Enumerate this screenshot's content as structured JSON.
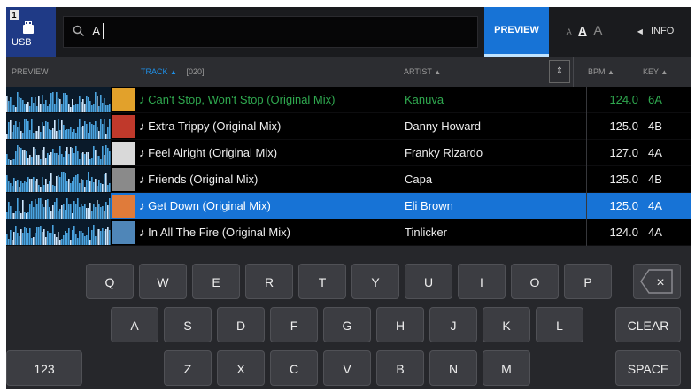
{
  "top_bar": {
    "source_number": "1",
    "source_label": "USB",
    "search_query": "A",
    "preview_label": "PREVIEW",
    "font_size_glyphs": [
      "A",
      "A",
      "A"
    ],
    "info_label": "INFO"
  },
  "columns": {
    "preview": "PREVIEW",
    "track": "TRACK",
    "track_count": "[020]",
    "artist": "ARTIST",
    "bpm": "BPM",
    "key": "KEY"
  },
  "tracks": [
    {
      "title": "Can't Stop, Won't Stop (Original Mix)",
      "artist": "Kanuva",
      "bpm": "124.0",
      "key": "6A",
      "state": "playing"
    },
    {
      "title": "Extra Trippy (Original Mix)",
      "artist": "Danny Howard",
      "bpm": "125.0",
      "key": "4B",
      "state": ""
    },
    {
      "title": "Feel Alright (Original Mix)",
      "artist": "Franky Rizardo",
      "bpm": "127.0",
      "key": "4A",
      "state": ""
    },
    {
      "title": "Friends  (Original Mix)",
      "artist": "Capa",
      "bpm": "125.0",
      "key": "4B",
      "state": ""
    },
    {
      "title": "Get Down (Original Mix)",
      "artist": "Eli Brown",
      "bpm": "125.0",
      "key": "4A",
      "state": "selected"
    },
    {
      "title": "In All The Fire (Original Mix)",
      "artist": "Tinlicker",
      "bpm": "124.0",
      "key": "4A",
      "state": ""
    }
  ],
  "keyboard": {
    "row1": [
      "Q",
      "W",
      "E",
      "R",
      "T",
      "Y",
      "U",
      "I",
      "O",
      "P"
    ],
    "row2": [
      "A",
      "S",
      "D",
      "F",
      "G",
      "H",
      "J",
      "K",
      "L"
    ],
    "row3": [
      "Z",
      "X",
      "C",
      "V",
      "B",
      "N",
      "M"
    ],
    "mode_key": "123",
    "backspace_label": "×",
    "clear_label": "CLEAR",
    "space_label": "SPACE"
  },
  "colors": {
    "accent_blue": "#1773d6",
    "playing_green": "#2fa84f",
    "waveform_blue": "#4aa3df"
  },
  "icons": {
    "search": "magnifier-icon",
    "sort_up": "triangle-up-icon",
    "info_arrow": "triangle-left-icon",
    "backspace": "backspace-icon",
    "note": "music-note-icon",
    "source": "usb-icon"
  }
}
